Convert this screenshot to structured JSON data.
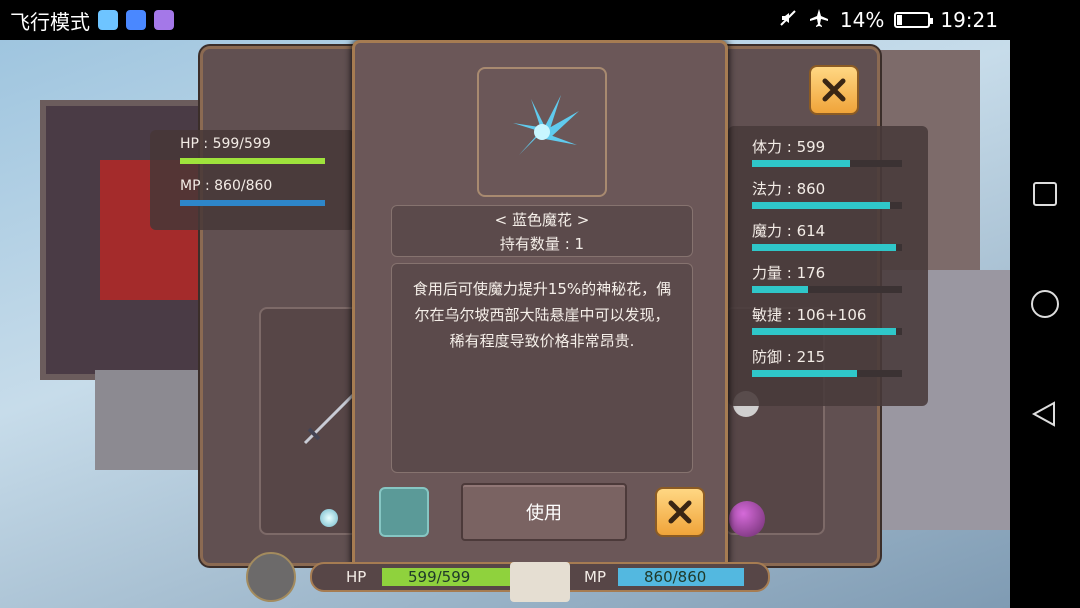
{
  "status_bar": {
    "mode_label": "飞行模式",
    "battery_percent": "14%",
    "time": "19:21",
    "apps": [
      {
        "name": "app-icon-1",
        "color": "#6ec4ff"
      },
      {
        "name": "app-icon-2",
        "color": "#4a88ff"
      },
      {
        "name": "app-icon-3",
        "color": "#a478e8"
      }
    ]
  },
  "nav": {
    "recent": "square",
    "home": "circle",
    "back": "triangle"
  },
  "left_stats": {
    "hp_label": "HP : 599/599",
    "hp_fraction": 1.0,
    "hp_color": "#9fe33c",
    "mp_label": "MP : 860/860",
    "mp_fraction": 1.0,
    "mp_color": "#2e86c9"
  },
  "attributes": [
    {
      "label": "体力 : 599",
      "fraction": 0.65
    },
    {
      "label": "法力 : 860",
      "fraction": 0.92
    },
    {
      "label": "魔力 : 614",
      "fraction": 0.96
    },
    {
      "label": "力量 : 176",
      "fraction": 0.37
    },
    {
      "label": "敏捷 : 106+106",
      "fraction": 0.96
    },
    {
      "label": "防御 : 215",
      "fraction": 0.7
    }
  ],
  "item_popup": {
    "item_name": "< 蓝色魔花 >",
    "quantity": "持有数量 : 1",
    "description": "食用后可使魔力提升15%的神秘花，偶尔在乌尔坡西部大陆悬崖中可以发现，稀有程度导致价格非常昂贵.",
    "use_label": "使用",
    "accent_color": "#5fd8ff"
  },
  "bottom_hud": {
    "hp_label": "HP",
    "hp_value": "599/599",
    "hp_color": "#8fd23d",
    "mp_label": "MP",
    "mp_value": "860/860",
    "mp_color": "#53b8e0"
  }
}
